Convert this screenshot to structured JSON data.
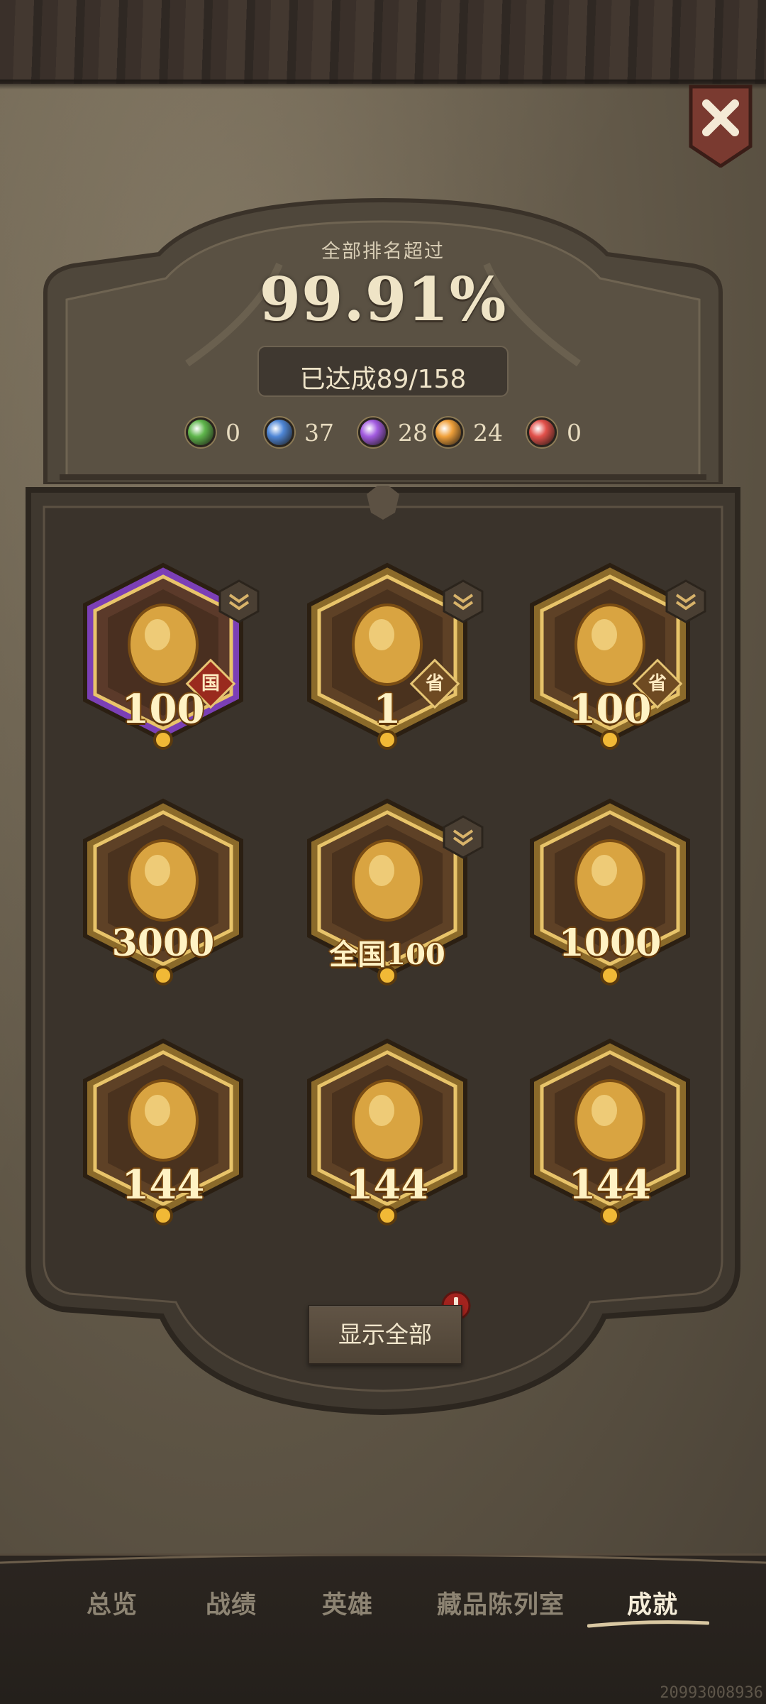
{
  "header": {
    "rank_label": "全部排名超过",
    "rank_value": "99.91%",
    "achieved_text": "已达成89/158"
  },
  "gem_counts": [
    {
      "name": "green",
      "color": "#5fb64c",
      "count": "0"
    },
    {
      "name": "blue",
      "color": "#4e86d6",
      "count": "37"
    },
    {
      "name": "purple",
      "color": "#a25be0",
      "count": "28"
    },
    {
      "name": "orange",
      "color": "#f0a03a",
      "count": "24"
    },
    {
      "name": "red",
      "color": "#e2504a",
      "count": "0"
    }
  ],
  "achievements": [
    {
      "label": "100",
      "region": "国",
      "icon": "trophy-wings-icon",
      "frame": "purple",
      "expandable": true
    },
    {
      "label": "1",
      "region": "省",
      "icon": "trophy-crown-icon",
      "frame": "gold",
      "expandable": true
    },
    {
      "label": "100",
      "region": "省",
      "icon": "crystal-trophy-icon",
      "frame": "gold",
      "expandable": true
    },
    {
      "label": "3000",
      "region": "",
      "icon": "pumpkin-icon",
      "frame": "gold",
      "expandable": false
    },
    {
      "label": "全国100",
      "region": "",
      "icon": "hooded-figure-icon",
      "frame": "gold",
      "expandable": true
    },
    {
      "label": "1000",
      "region": "",
      "icon": "sword-crest-icon",
      "frame": "gold",
      "expandable": false
    },
    {
      "label": "144",
      "region": "",
      "icon": "vinyl-record-icon",
      "frame": "gold",
      "expandable": false
    },
    {
      "label": "144",
      "region": "",
      "icon": "gourd-icon",
      "frame": "gold",
      "expandable": false
    },
    {
      "label": "144",
      "region": "",
      "icon": "sun-mascot-icon",
      "frame": "gold",
      "expandable": false
    }
  ],
  "show_all_label": "显示全部",
  "tabs": [
    {
      "label": "总览",
      "active": false
    },
    {
      "label": "战绩",
      "active": false
    },
    {
      "label": "英雄",
      "active": false
    },
    {
      "label": "藏品陈列室",
      "active": false
    },
    {
      "label": "成就",
      "active": true
    }
  ],
  "user_id": "20993008936"
}
